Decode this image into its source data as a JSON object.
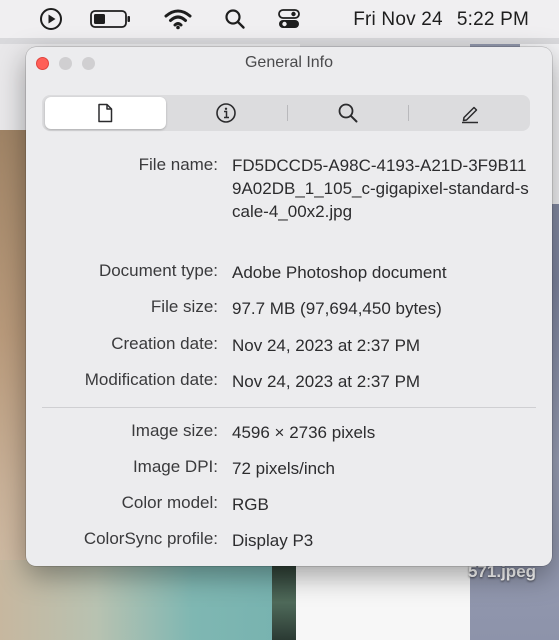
{
  "menubar": {
    "day": "Fri Nov 24",
    "time": "5:22 PM",
    "icons": [
      "play-circle-icon",
      "battery-icon",
      "wifi-icon",
      "spotlight-search-icon",
      "control-center-icon"
    ]
  },
  "desktop": {
    "label": "571.jpeg"
  },
  "window": {
    "title": "General Info",
    "tabs": [
      {
        "icon": "document-icon",
        "active": true
      },
      {
        "icon": "info-icon",
        "active": false
      },
      {
        "icon": "magnifier-icon",
        "active": false
      },
      {
        "icon": "pencil-icon",
        "active": false
      }
    ],
    "file_info": [
      {
        "label": "File name:",
        "value": "FD5DCCD5-A98C-4193-A21D-3F9B119A02DB_1_105_c-gigapixel-standard-scale-4_00x2.jpg"
      },
      {
        "label": "Document type:",
        "value": "Adobe Photoshop document"
      },
      {
        "label": "File size:",
        "value": "97.7 MB (97,694,450 bytes)"
      },
      {
        "label": "Creation date:",
        "value": "Nov 24, 2023 at 2:37 PM"
      },
      {
        "label": "Modification date:",
        "value": "Nov 24, 2023 at 2:37 PM"
      }
    ],
    "image_info": [
      {
        "label": "Image size:",
        "value": "4596 × 2736 pixels"
      },
      {
        "label": "Image DPI:",
        "value": "72 pixels/inch"
      },
      {
        "label": "Color model:",
        "value": "RGB"
      },
      {
        "label": "ColorSync profile:",
        "value": "Display P3"
      }
    ]
  },
  "colors": {
    "close_button": "#ff5f57",
    "window_bg": "#ececee",
    "menubar_bg": "#f0eff1"
  }
}
